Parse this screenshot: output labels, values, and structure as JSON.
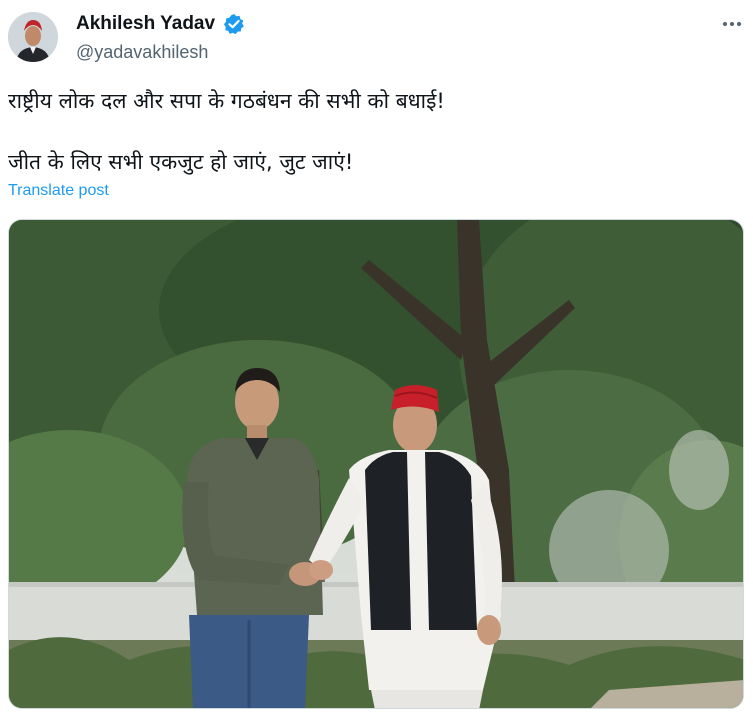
{
  "author": {
    "display_name": "Akhilesh Yadav",
    "handle": "@yadavakhilesh",
    "verified": true,
    "avatar_icon": "profile-photo"
  },
  "post": {
    "lines": [
      "राष्ट्रीय लोक दल और सपा के गठबंधन की सभी को बधाई!",
      "जीत के लिए सभी एकजुट हो जाएं, जुट जाएं!"
    ],
    "translate_label": "Translate post"
  },
  "icons": {
    "more": "more-options-icon",
    "verified": "verified-badge-icon"
  },
  "colors": {
    "link": "#1d9bf0",
    "verified": "#1d9bf0",
    "secondary_text": "#536471"
  }
}
